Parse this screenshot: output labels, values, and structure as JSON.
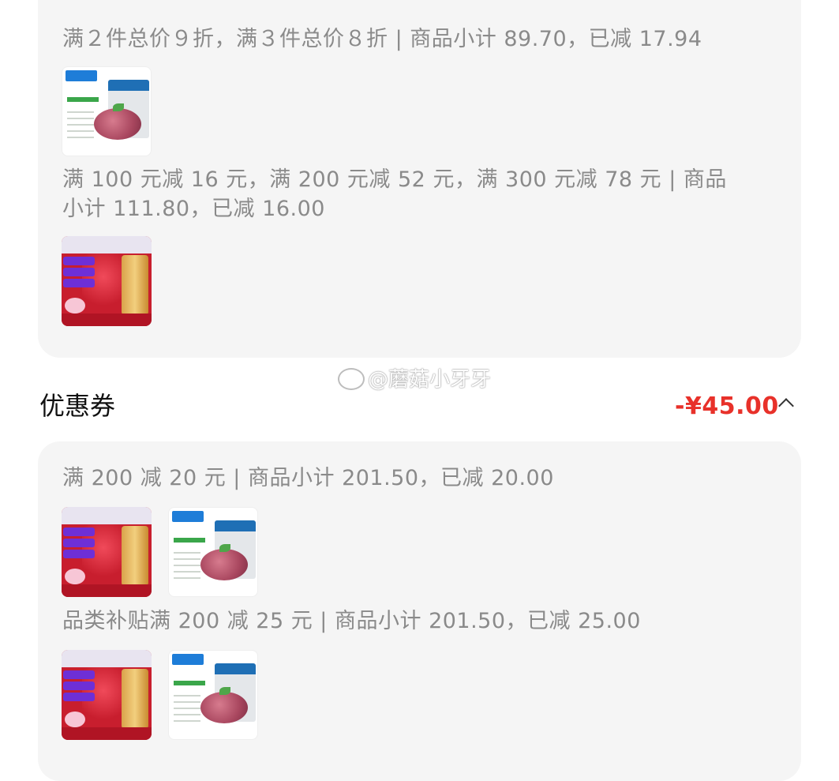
{
  "promotions": {
    "items": [
      {
        "text": "满２件总价９折，满３件总价８折 | 商品小计 89.70，已减 17.94"
      },
      {
        "text": "满 100 元减 16 元，满 200 元减 52 元，满 300 元减 78 元 | 商品小计 111.80，已减 16.00"
      }
    ]
  },
  "coupons": {
    "title": "优惠券",
    "total": "-¥45.00",
    "items": [
      {
        "text": "满 200 减 20 元 | 商品小计 201.50，已减 20.00"
      },
      {
        "text": "品类补贴满 200 减 25 元 | 商品小计 201.50，已减 25.00"
      }
    ]
  },
  "watermark": "@蘑菇小牙牙",
  "icons": [
    "chevron-up-icon",
    "weibo-icon"
  ],
  "colors": {
    "accent": "#e8312a",
    "card_bg": "#f5f5f5"
  }
}
